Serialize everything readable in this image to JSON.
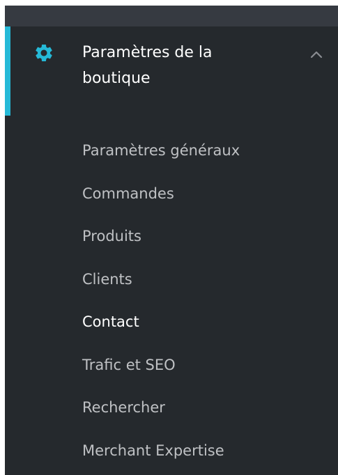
{
  "sidebar": {
    "section": {
      "icon": "gear-icon",
      "title": "Paramètres de la boutique",
      "expanded": true,
      "expand_icon": "chevron-up-icon",
      "accent_color": "#25b9d7"
    },
    "items": [
      {
        "label": "Paramètres généraux",
        "active": false
      },
      {
        "label": "Commandes",
        "active": false
      },
      {
        "label": "Produits",
        "active": false
      },
      {
        "label": "Clients",
        "active": false
      },
      {
        "label": "Contact",
        "active": true
      },
      {
        "label": "Trafic et SEO",
        "active": false
      },
      {
        "label": "Rechercher",
        "active": false
      },
      {
        "label": "Merchant Expertise",
        "active": false
      }
    ]
  },
  "colors": {
    "background": "#25292d",
    "top_strip": "#363a41",
    "text": "#bfc1c4",
    "text_active": "#ffffff"
  }
}
